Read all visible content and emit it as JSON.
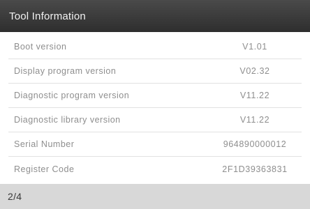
{
  "header": {
    "title": "Tool Information"
  },
  "rows": [
    {
      "label": "Boot version",
      "value": "V1.01"
    },
    {
      "label": "Display program version",
      "value": "V02.32"
    },
    {
      "label": "Diagnostic program version",
      "value": "V11.22"
    },
    {
      "label": "Diagnostic library version",
      "value": "V11.22"
    },
    {
      "label": "Serial Number",
      "value": "964890000012"
    },
    {
      "label": "Register Code",
      "value": "2F1D39363831"
    }
  ],
  "footer": {
    "page": "2/4"
  },
  "colors": {
    "title_bar": "#3a3a3a",
    "footer_bar": "#d8d8d8",
    "text_muted": "#8e8e8e"
  }
}
